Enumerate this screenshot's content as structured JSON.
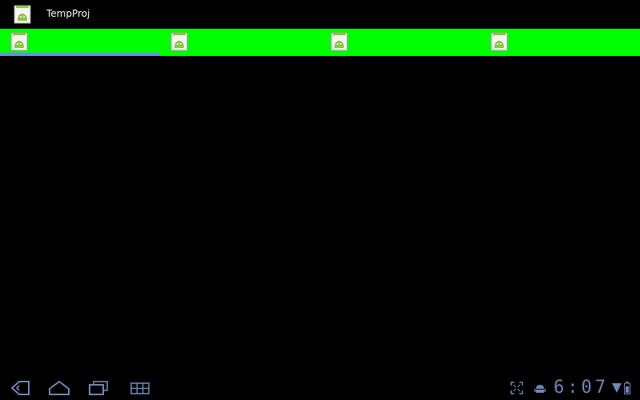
{
  "app": {
    "title": "TempProj",
    "icon": "android-app-icon"
  },
  "tabs": [
    {
      "icon": "android-app-icon",
      "selected": true
    },
    {
      "icon": "android-app-icon",
      "selected": false
    },
    {
      "icon": "android-app-icon",
      "selected": false
    },
    {
      "icon": "android-app-icon",
      "selected": false
    }
  ],
  "system_bar": {
    "clock": "6:07",
    "nav_buttons": [
      "back-icon",
      "home-icon",
      "recent-apps-icon",
      "menu-grid-icon"
    ],
    "status_icons": [
      "screen-compat-icon",
      "android-debug-icon",
      "wifi-icon",
      "battery-icon"
    ]
  },
  "colors": {
    "tab_bar_bg": "#00ff00",
    "tab_indicator": "#6b8fe0",
    "system_icon": "#6f86b8",
    "background": "#000000"
  }
}
